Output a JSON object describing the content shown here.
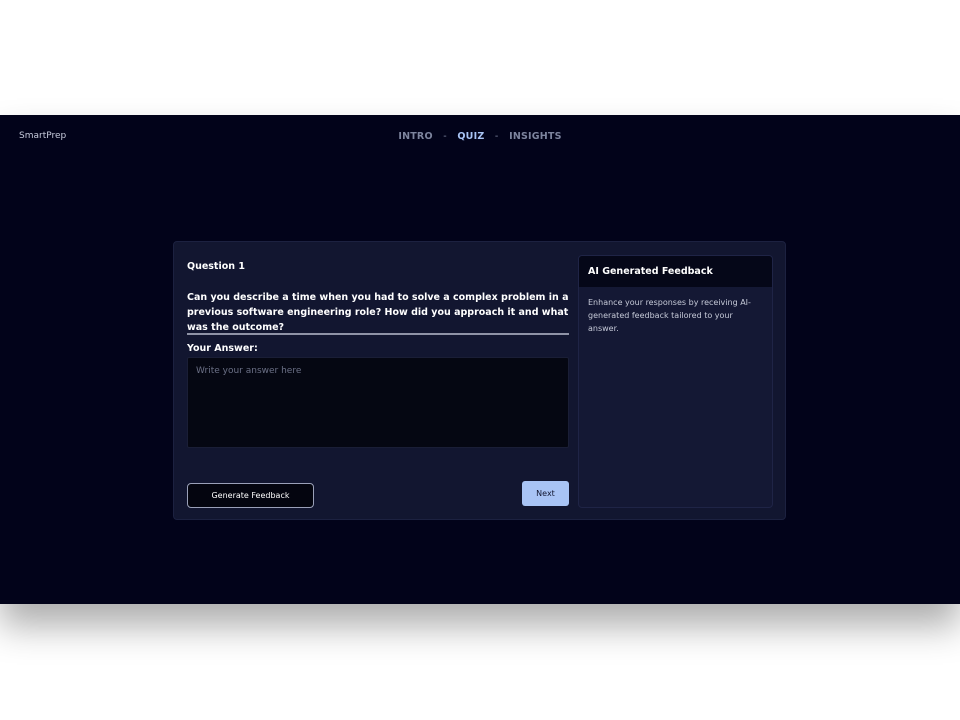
{
  "header": {
    "brand": "SmartPrep",
    "nav": [
      {
        "label": "INTRO",
        "active": false
      },
      {
        "label": "QUIZ",
        "active": true
      },
      {
        "label": "INSIGHTS",
        "active": false
      }
    ],
    "separator": "-"
  },
  "quiz": {
    "question_title": "Question 1",
    "question_text": "Can you describe a time when you had to solve a complex problem in a previous software engineering role? How did you approach it and what was the outcome?",
    "answer_label": "Your Answer:",
    "answer_value": "",
    "answer_placeholder": "Write your answer here",
    "generate_button": "Generate Feedback",
    "next_button": "Next"
  },
  "feedback": {
    "title": "AI Generated Feedback",
    "body": "Enhance your responses by receiving AI-generated feedback tailored to your answer."
  },
  "colors": {
    "app_background": "#02031a",
    "card_background": "#121630",
    "accent": "#a9c4f5"
  }
}
